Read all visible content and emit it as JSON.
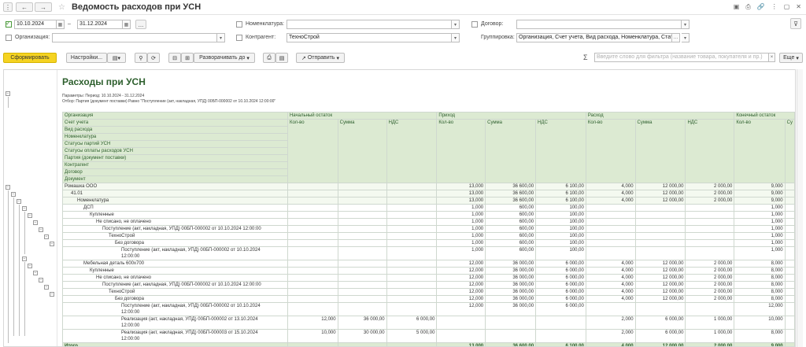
{
  "window": {
    "title": "Ведомость расходов при УСН"
  },
  "filters": {
    "date_from": "10.10.2024",
    "date_sep": "–",
    "date_to": "31.12.2024",
    "nomenclature_label": "Номенклатура:",
    "contract_label": "Договор:",
    "organization_label": "Организация:",
    "counterparty_label": "Контрагент:",
    "counterparty_value": "ТехноСтрой",
    "grouping_label": "Группировка:",
    "grouping_value": "Организация, Счет учета, Вид расхода, Номенклатура, Стат"
  },
  "toolbar": {
    "generate": "Сформировать",
    "settings": "Настройки...",
    "expand": "Разворачивать до",
    "send": "Отправить",
    "search_placeholder": "Введите слово для фильтра (название товара, покупателя и пр.)",
    "more": "Еще"
  },
  "report": {
    "title": "Расходы при УСН",
    "params": "Параметры: Период: 10.10.2024 - 31.12.2024",
    "filter": "Отбор:      Партия (документ поставки) Равно \"Поступление (акт, накладная, УПД) 00БП-000002 от 10.10.2024 12:00:00\"",
    "header_left": [
      "Организация",
      "Счет учета",
      "Вид расхода",
      "Номенклатура",
      "Статусы партий УСН",
      "Статусы оплаты расходов УСН",
      "Партия (документ поставки)",
      "Контрагент",
      "Договор",
      "Документ"
    ],
    "groups": [
      "Начальный остаток",
      "Приход",
      "Расход",
      "Конечный остаток"
    ],
    "subcols": [
      "Кол-во",
      "Сумма",
      "НДС",
      "Кол-во",
      "Сумма",
      "НДС",
      "Кол-во",
      "Сумма",
      "НДС",
      "Кол-во",
      "Су"
    ],
    "rows": [
      {
        "label": "Ромашка ООО",
        "ind": 0,
        "grp": true,
        "v": [
          "",
          "",
          "",
          "13,000",
          "36 600,00",
          "6 100,00",
          "4,000",
          "12 000,00",
          "2 000,00",
          "9,000"
        ]
      },
      {
        "label": "41.01",
        "ind": 1,
        "grp": true,
        "v": [
          "",
          "",
          "",
          "13,000",
          "36 600,00",
          "6 100,00",
          "4,000",
          "12 000,00",
          "2 000,00",
          "9,000"
        ]
      },
      {
        "label": "Номенклатура",
        "ind": 2,
        "grp": true,
        "v": [
          "",
          "",
          "",
          "13,000",
          "36 600,00",
          "6 100,00",
          "4,000",
          "12 000,00",
          "2 000,00",
          "9,000"
        ]
      },
      {
        "label": "ДСП",
        "ind": 3,
        "v": [
          "",
          "",
          "",
          "1,000",
          "600,00",
          "100,00",
          "",
          "",
          "",
          "1,000"
        ]
      },
      {
        "label": "Купленные",
        "ind": 4,
        "v": [
          "",
          "",
          "",
          "1,000",
          "600,00",
          "100,00",
          "",
          "",
          "",
          "1,000"
        ]
      },
      {
        "label": "Не списано, не оплачено",
        "ind": 5,
        "v": [
          "",
          "",
          "",
          "1,000",
          "600,00",
          "100,00",
          "",
          "",
          "",
          "1,000"
        ]
      },
      {
        "label": "Поступление (акт, накладная, УПД) 00БП-000002 от 10.10.2024 12:00:00",
        "ind": 6,
        "v": [
          "",
          "",
          "",
          "1,000",
          "600,00",
          "100,00",
          "",
          "",
          "",
          "1,000"
        ]
      },
      {
        "label": "ТехноСтрой",
        "ind": 7,
        "v": [
          "",
          "",
          "",
          "1,000",
          "600,00",
          "100,00",
          "",
          "",
          "",
          "1,000"
        ]
      },
      {
        "label": "Без договора",
        "ind": 8,
        "v": [
          "",
          "",
          "",
          "1,000",
          "600,00",
          "100,00",
          "",
          "",
          "",
          "1,000"
        ]
      },
      {
        "label": "Поступление (акт, накладная, УПД) 00БП-000002 от 10.10.2024",
        "label2": "12:00:00",
        "ind": 9,
        "v": [
          "",
          "",
          "",
          "1,000",
          "600,00",
          "100,00",
          "",
          "",
          "",
          "1,000"
        ]
      },
      {
        "label": "Мебельная деталь 600х700",
        "ind": 3,
        "v": [
          "",
          "",
          "",
          "12,000",
          "36 000,00",
          "6 000,00",
          "4,000",
          "12 000,00",
          "2 000,00",
          "8,000"
        ]
      },
      {
        "label": "Купленные",
        "ind": 4,
        "v": [
          "",
          "",
          "",
          "12,000",
          "36 000,00",
          "6 000,00",
          "4,000",
          "12 000,00",
          "2 000,00",
          "8,000"
        ]
      },
      {
        "label": "Не списано, не оплачено",
        "ind": 5,
        "v": [
          "",
          "",
          "",
          "12,000",
          "36 000,00",
          "6 000,00",
          "4,000",
          "12 000,00",
          "2 000,00",
          "8,000"
        ]
      },
      {
        "label": "Поступление (акт, накладная, УПД) 00БП-000002 от 10.10.2024 12:00:00",
        "ind": 6,
        "v": [
          "",
          "",
          "",
          "12,000",
          "36 000,00",
          "6 000,00",
          "4,000",
          "12 000,00",
          "2 000,00",
          "8,000"
        ]
      },
      {
        "label": "ТехноСтрой",
        "ind": 7,
        "v": [
          "",
          "",
          "",
          "12,000",
          "36 000,00",
          "6 000,00",
          "4,000",
          "12 000,00",
          "2 000,00",
          "8,000"
        ]
      },
      {
        "label": "Без договора",
        "ind": 8,
        "v": [
          "",
          "",
          "",
          "12,000",
          "36 000,00",
          "6 000,00",
          "4,000",
          "12 000,00",
          "2 000,00",
          "8,000"
        ]
      },
      {
        "label": "Поступление (акт, накладная, УПД) 00БП-000002 от 10.10.2024",
        "label2": "12:00:00",
        "ind": 9,
        "v": [
          "",
          "",
          "",
          "12,000",
          "36 000,00",
          "6 000,00",
          "",
          "",
          "",
          "12,000"
        ]
      },
      {
        "label": "Реализация (акт, накладная, УПД) 00БП-000002 от 13.10.2024",
        "label2": "12:00:00",
        "ind": 9,
        "v": [
          "12,000",
          "36 000,00",
          "6 000,00",
          "",
          "",
          "",
          "2,000",
          "6 000,00",
          "1 000,00",
          "10,000"
        ]
      },
      {
        "label": "Реализация (акт, накладная, УПД) 00БП-000003 от 15.10.2024",
        "label2": "12:00:00",
        "ind": 9,
        "v": [
          "10,000",
          "30 000,00",
          "5 000,00",
          "",
          "",
          "",
          "2,000",
          "6 000,00",
          "1 000,00",
          "8,000"
        ]
      }
    ],
    "total": {
      "label": "Итого",
      "v": [
        "",
        "",
        "",
        "13,000",
        "36 600,00",
        "6 100,00",
        "4,000",
        "12 000,00",
        "2 000,00",
        "9,000"
      ]
    }
  }
}
